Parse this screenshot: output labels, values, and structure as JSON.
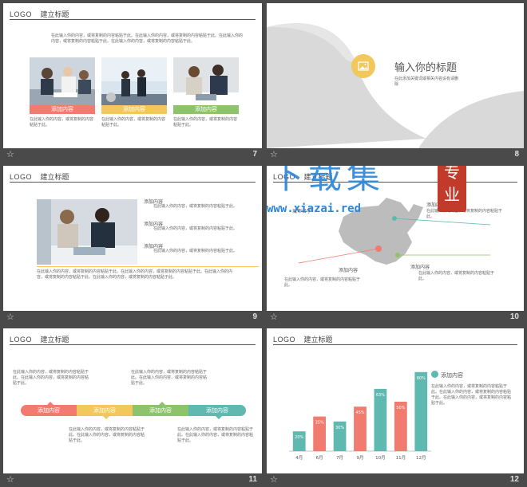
{
  "colors": {
    "coral": "#f07b6e",
    "gold": "#f2c75c",
    "green": "#8cc36b",
    "teal": "#5fb9b0",
    "background": "#4a4a4a"
  },
  "common": {
    "logo": "LOGO",
    "title": "建立标题",
    "add_content": "添加内容",
    "star_icon": "star-icon"
  },
  "slides": [
    {
      "num": "7",
      "intro": "在此输入你的内容，或将复制的内容粘贴于此。在此输入你的内容，或将复制的内容粘贴于此。在此输入你的内容，或将复制的内容粘贴于此。在此输入你的内容，或将复制的内容粘贴于此。",
      "columns": [
        {
          "label": "添加内容",
          "text": "在此输入你的内容，或将复制的内容粘贴于此。"
        },
        {
          "label": "添加内容",
          "text": "在此输入你的内容，或将复制的内容粘贴于此。"
        },
        {
          "label": "添加内容",
          "text": "在此输入你的内容，或将复制的内容粘贴于此。"
        }
      ]
    },
    {
      "num": "8",
      "heading": "输入你的标题",
      "sub": "在此添加关键词或相关内容设有请删除",
      "icon": "image-icon"
    },
    {
      "num": "9",
      "items": [
        {
          "label": "添加内容",
          "text": "在此输入你的内容，或将复制的内容粘贴于此。"
        },
        {
          "label": "添加内容",
          "text": "在此输入你的内容，或将复制的内容粘贴于此。"
        },
        {
          "label": "添加内容",
          "text": "在此输入你的内容，或将复制的内容粘贴于此。"
        }
      ],
      "footer": "在此输入你的内容，或将复制的内容粘贴于此。在此输入你的内容，或将复制的内容粘贴于此。在此输入你的内容，或将复制的内容粘贴于此。在此输入你的内容，或将复制的内容粘贴于此。"
    },
    {
      "num": "10",
      "map_label": "城市名字",
      "label_a": "添加内容",
      "label_b": "添加内容",
      "text": "在此输入你的内容，或将复制的内容粘贴于此。",
      "watermark_main": "下载集",
      "watermark_url": "www.xiazai.red",
      "watermark_seal": "专业"
    },
    {
      "num": "11",
      "steps": [
        "添加内容",
        "添加内容",
        "添加内容",
        "添加内容"
      ],
      "text": "在此输入你的内容，或将复制的内容粘贴于此。在此输入你的内容，或将复制的内容粘贴于此。"
    },
    {
      "num": "12",
      "side_label": "添加内容",
      "side_text": "在此输入你的内容，或将复制的内容粘贴于此。在此输入你的内容，或将复制的内容粘贴于此。在此输入你的内容，或将复制的内容粘贴于此。"
    }
  ],
  "chart_data": {
    "type": "bar",
    "categories": [
      "4月",
      "6月",
      "7月",
      "9月",
      "10月",
      "11月",
      "12月"
    ],
    "values": [
      20,
      35,
      30,
      45,
      63,
      50,
      80
    ],
    "value_labels": [
      "20%",
      "35%",
      "30%",
      "45%",
      "63%",
      "50%",
      "80%"
    ],
    "colors": [
      "#5fb9b0",
      "#f07b6e",
      "#5fb9b0",
      "#f07b6e",
      "#5fb9b0",
      "#f07b6e",
      "#5fb9b0"
    ],
    "ylim": [
      0,
      100
    ],
    "grid": false
  }
}
